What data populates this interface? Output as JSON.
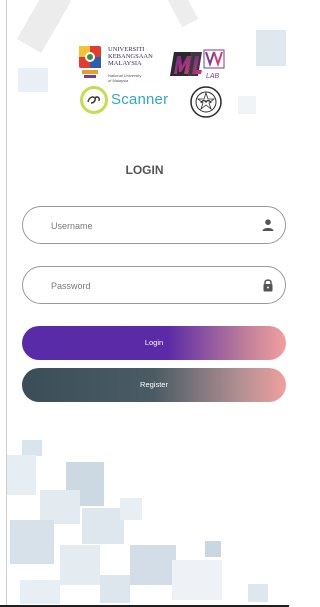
{
  "logos": {
    "ukm": {
      "name_lines": [
        "UNIVERSITI",
        "KEBANGSAAN",
        "MALAYSIA"
      ],
      "subtitle_lines": [
        "National University",
        "of Malaysia"
      ]
    },
    "mlv": {
      "text": "MLV",
      "sub": "LAB"
    },
    "scanner": {
      "word": "Scanner"
    },
    "halal": {
      "icon": "halal-seal-icon"
    }
  },
  "login": {
    "title": "LOGIN",
    "username_placeholder": "Username",
    "password_placeholder": "Password",
    "login_label": "Login",
    "register_label": "Register"
  },
  "colors": {
    "login_gradient_start": "#5a2ba8",
    "login_gradient_end": "#f2a0a0",
    "register_gradient_start": "#3b4e58",
    "register_gradient_end": "#f0a09c",
    "decor_square": "#dce6ee"
  },
  "icons": {
    "username": "person-icon",
    "password": "lock-icon"
  }
}
